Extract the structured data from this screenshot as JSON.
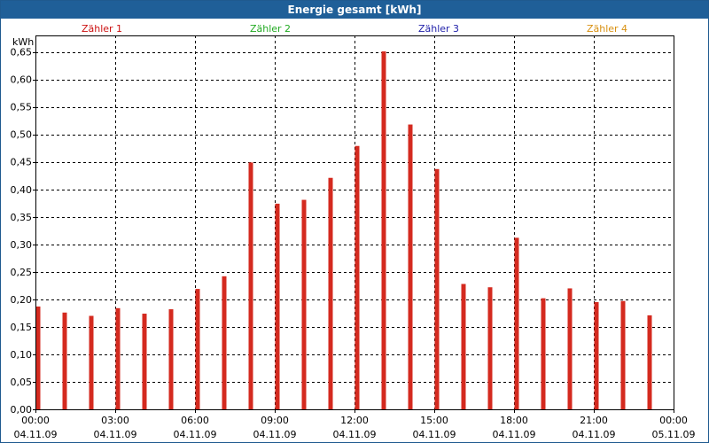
{
  "window": {
    "title": "Energie gesamt [kWh]"
  },
  "chart_data": {
    "type": "bar",
    "title": "Energie gesamt [kWh]",
    "ylabel": "kWh",
    "ylim": [
      0,
      0.68
    ],
    "yticks": [
      "0,00",
      "0,05",
      "0,10",
      "0,15",
      "0,20",
      "0,25",
      "0,30",
      "0,35",
      "0,40",
      "0,45",
      "0,50",
      "0,55",
      "0,60",
      "0,65"
    ],
    "yticks_values": [
      0,
      0.05,
      0.1,
      0.15,
      0.2,
      0.25,
      0.3,
      0.35,
      0.4,
      0.45,
      0.5,
      0.55,
      0.6,
      0.65
    ],
    "xlim_hours": [
      0,
      24
    ],
    "xticks": [
      {
        "hour": 0,
        "time": "00:00",
        "date": "04.11.09"
      },
      {
        "hour": 3,
        "time": "03:00",
        "date": "04.11.09"
      },
      {
        "hour": 6,
        "time": "06:00",
        "date": "04.11.09"
      },
      {
        "hour": 9,
        "time": "09:00",
        "date": "04.11.09"
      },
      {
        "hour": 12,
        "time": "12:00",
        "date": "04.11.09"
      },
      {
        "hour": 15,
        "time": "15:00",
        "date": "04.11.09"
      },
      {
        "hour": 18,
        "time": "18:00",
        "date": "04.11.09"
      },
      {
        "hour": 21,
        "time": "21:00",
        "date": "04.11.09"
      },
      {
        "hour": 24,
        "time": "00:00",
        "date": "05.11.09"
      }
    ],
    "legend": [
      {
        "name": "Zähler 1",
        "color": "#cc1111"
      },
      {
        "name": "Zähler 2",
        "color": "#22aa22"
      },
      {
        "name": "Zähler 3",
        "color": "#2222aa"
      },
      {
        "name": "Zähler 4",
        "color": "#d89010"
      }
    ],
    "series": [
      {
        "name": "Zähler 1",
        "color": "#d42a1f",
        "hours": [
          0.1,
          1.1,
          2.1,
          3.1,
          4.1,
          5.1,
          6.1,
          7.1,
          8.1,
          9.1,
          10.1,
          11.1,
          12.1,
          13.1,
          14.1,
          15.1,
          16.1,
          17.1,
          18.1,
          19.1,
          20.1,
          21.1,
          22.1,
          23.1
        ],
        "values": [
          0.187,
          0.176,
          0.17,
          0.184,
          0.174,
          0.182,
          0.219,
          0.242,
          0.449,
          0.374,
          0.381,
          0.421,
          0.479,
          0.651,
          0.518,
          0.437,
          0.228,
          0.222,
          0.312,
          0.202,
          0.22,
          0.195,
          0.197,
          0.171
        ]
      }
    ],
    "grid": true,
    "legend_placement": "top"
  }
}
